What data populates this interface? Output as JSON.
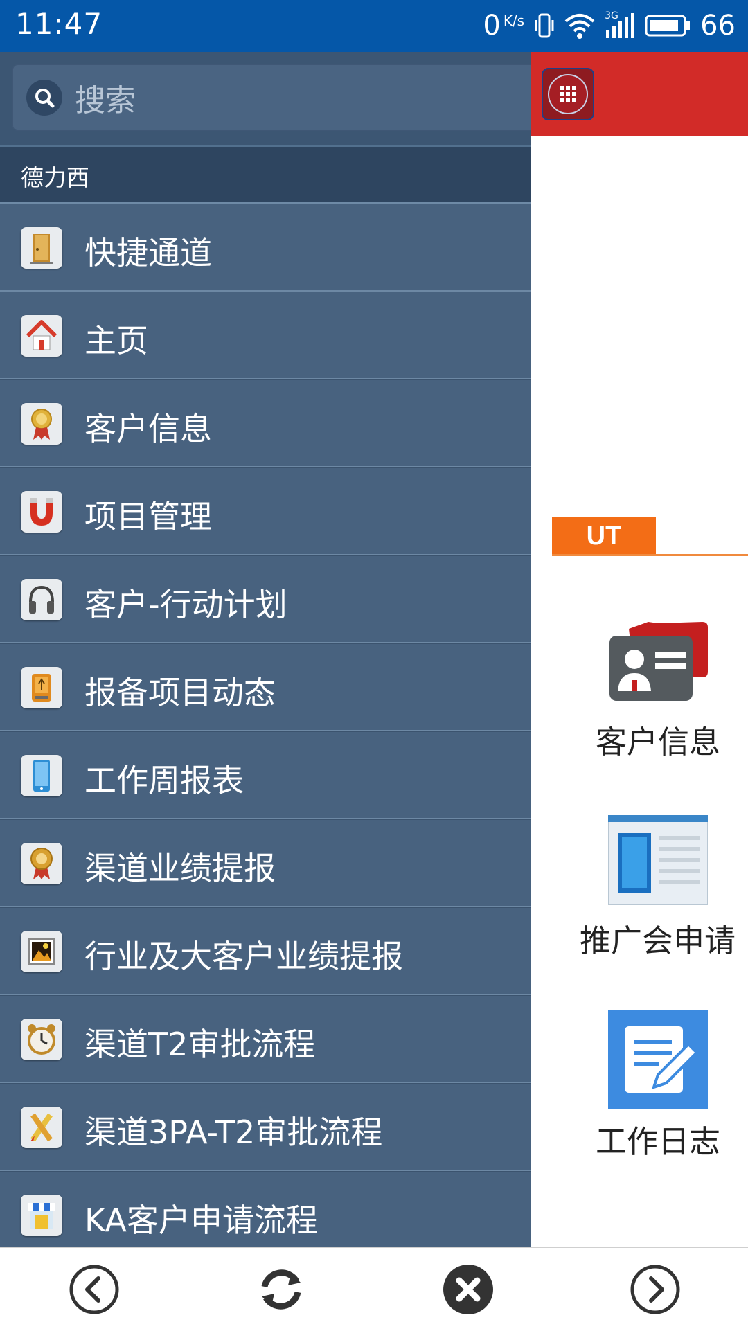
{
  "status_bar": {
    "time": "11:47",
    "net_speed": "0",
    "net_unit": "K/s",
    "network_type": "3G",
    "battery_level": "66"
  },
  "drawer": {
    "search_placeholder": "搜索",
    "section_label": "德力西",
    "items": [
      {
        "label": "快捷通道",
        "icon": "door-icon"
      },
      {
        "label": "主页",
        "icon": "home-icon"
      },
      {
        "label": "客户信息",
        "icon": "certificate-icon"
      },
      {
        "label": "项目管理",
        "icon": "magnet-icon"
      },
      {
        "label": "客户-行动计划",
        "icon": "headphones-icon"
      },
      {
        "label": "报备项目动态",
        "icon": "usb-drive-icon"
      },
      {
        "label": "工作周报表",
        "icon": "phone-icon"
      },
      {
        "label": "渠道业绩提报",
        "icon": "medal-icon"
      },
      {
        "label": "行业及大客户业绩提报",
        "icon": "picture-icon"
      },
      {
        "label": "渠道T2审批流程",
        "icon": "alarm-clock-icon"
      },
      {
        "label": "渠道3PA-T2审批流程",
        "icon": "pencil-ruler-icon"
      },
      {
        "label": "KA客户申请流程",
        "icon": "shop-icon"
      }
    ]
  },
  "main": {
    "tab_label": "UT",
    "tiles": [
      {
        "label": "客户信息",
        "icon": "contact-card-icon"
      },
      {
        "label": "推广会申请",
        "icon": "document-icon"
      },
      {
        "label": "工作日志",
        "icon": "edit-note-icon"
      }
    ]
  },
  "colors": {
    "status_bar": "#0557a8",
    "drawer_bg": "#48627f",
    "header_red": "#d22b28",
    "tab_orange": "#f36d16"
  },
  "bottom_nav": {
    "buttons": [
      "back-icon",
      "refresh-icon",
      "close-icon",
      "forward-icon"
    ]
  }
}
